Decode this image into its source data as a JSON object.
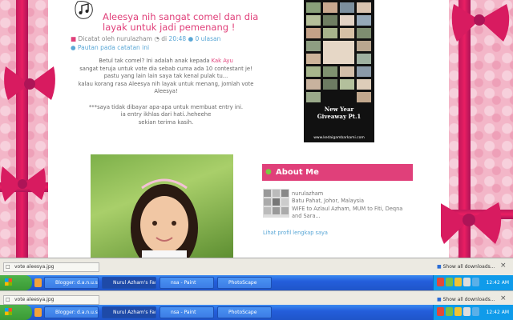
{
  "post": {
    "title": "Aleesya nih sangat comel dan dia layak untuk jadi pemenang !",
    "meta_posted": "Dicatat oleh nurulazham",
    "meta_at": "di",
    "meta_time": "20:48",
    "meta_comments": "0 ulasan",
    "meta_link": "Pautan pada catatan ini",
    "body": [
      [
        "Betul tak comel? Ini adalah anak kepada ",
        "Kak Ayu"
      ],
      [
        "sangat teruja untuk vote dia sebab cuma ada 10 contestant je!",
        ""
      ],
      [
        "pastu yang lain lain saya tak kenal pulak tu...",
        ""
      ],
      [
        "kalau korang rasa Aleesya nih layak untuk menang, jomlah vote",
        ""
      ],
      [
        "Aleesya!",
        ""
      ],
      [
        "",
        ""
      ],
      [
        "***saya tidak dibayar apa-apa untuk membuat entry ini.",
        ""
      ],
      [
        "ia entry ikhlas dari hati..heheehe",
        ""
      ],
      [
        "sekian terima kasih.",
        ""
      ]
    ]
  },
  "sidebar": {
    "giveaway_line1": "New Year",
    "giveaway_line2": "Giveaway Pt.1",
    "giveaway_url": "www.kedaigambarkami.com",
    "about_title": "About Me",
    "about_lines": [
      "nurulazham",
      "Batu Pahat, Johor, Malaysia",
      "WIFE to Azlaul Azham, MUM to Fiti, Deqna",
      "and Sara..."
    ],
    "profile_link": "Lihat profil lengkap saya"
  },
  "downloads": {
    "file": "vote aleesya.jpg",
    "show_all": "Show all downloads...",
    "close": "×"
  },
  "taskbar": {
    "start": "start",
    "buttons": [
      "Blogger: d.a.n.u.s.a.l.",
      "Nurul Azham's Family ...",
      "nsa - Paint",
      "PhotoScape"
    ],
    "clock": "12:42 AM"
  },
  "colors": {
    "accent": "#e0407a",
    "link": "#5aa7d6",
    "ribbon": "#e91e63",
    "taskbar": "#245edb",
    "start": "#3a9a35"
  }
}
